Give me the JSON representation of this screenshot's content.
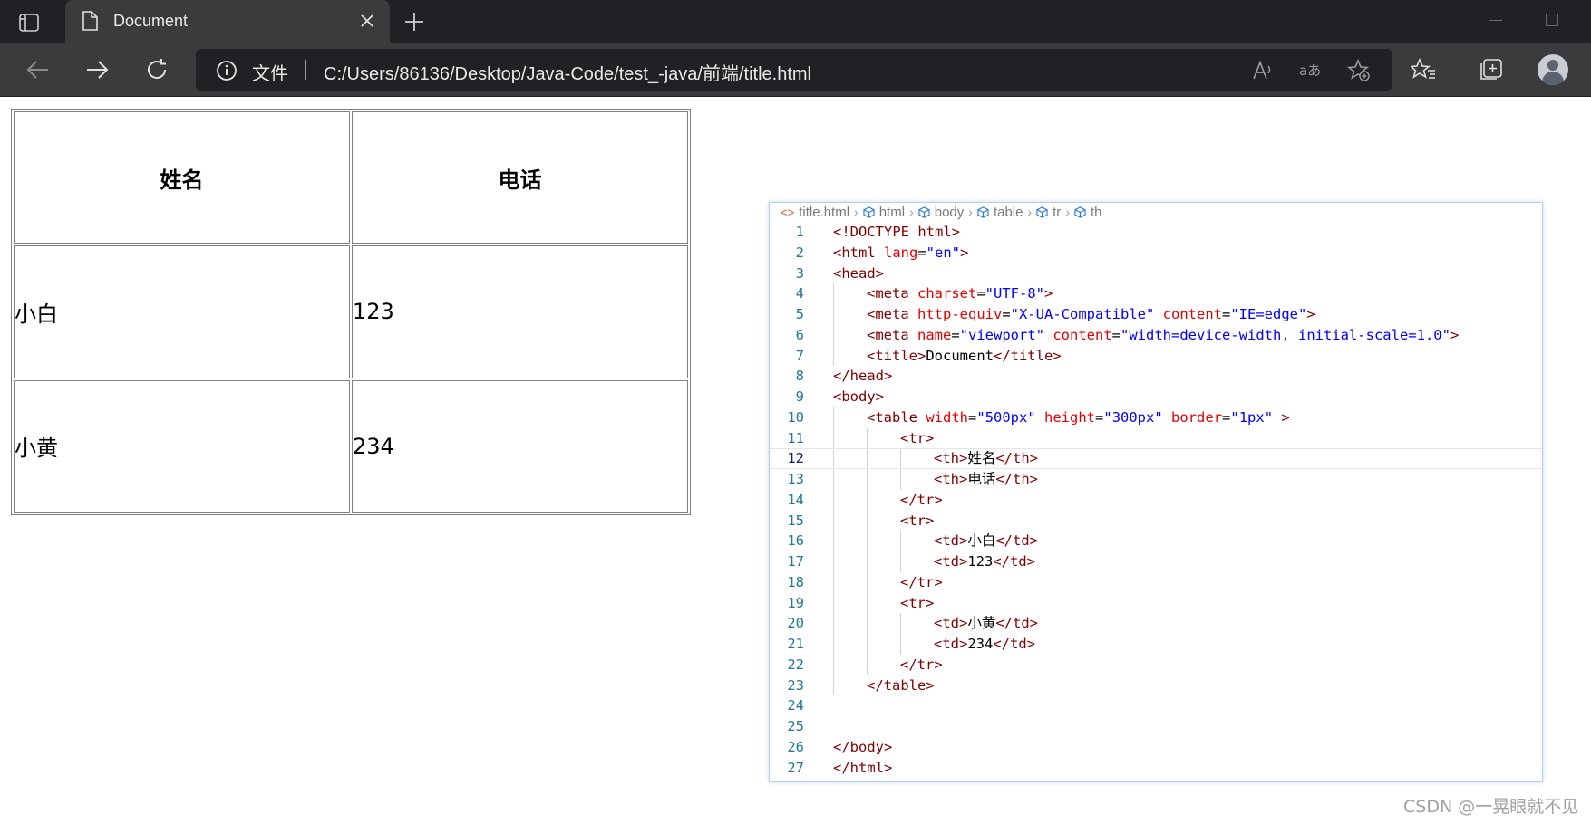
{
  "browser": {
    "tab_title": "Document",
    "address": {
      "label": "文件",
      "url": "C:/Users/86136/Desktop/Java-Code/test_-java/前端/title.html"
    }
  },
  "page_table": {
    "headers": [
      "姓名",
      "电话"
    ],
    "rows": [
      [
        "小白",
        "123"
      ],
      [
        "小黄",
        "234"
      ]
    ]
  },
  "editor": {
    "breadcrumbs": [
      "title.html",
      "html",
      "body",
      "table",
      "tr",
      "th"
    ],
    "current_line": 12,
    "lines": [
      {
        "n": "1",
        "indent": 0,
        "tokens": [
          [
            "t-tag",
            "<!DOCTYPE html>"
          ]
        ]
      },
      {
        "n": "2",
        "indent": 0,
        "tokens": [
          [
            "t-tag",
            "<html "
          ],
          [
            "t-attr",
            "lang"
          ],
          [
            "t-text",
            "="
          ],
          [
            "t-val",
            "\"en\""
          ],
          [
            "t-tag",
            ">"
          ]
        ]
      },
      {
        "n": "3",
        "indent": 0,
        "tokens": [
          [
            "t-tag",
            "<head>"
          ]
        ]
      },
      {
        "n": "4",
        "indent": 1,
        "tokens": [
          [
            "t-tag",
            "<meta "
          ],
          [
            "t-attr",
            "charset"
          ],
          [
            "t-text",
            "="
          ],
          [
            "t-val",
            "\"UTF-8\""
          ],
          [
            "t-tag",
            ">"
          ]
        ]
      },
      {
        "n": "5",
        "indent": 1,
        "tokens": [
          [
            "t-tag",
            "<meta "
          ],
          [
            "t-attr",
            "http-equiv"
          ],
          [
            "t-text",
            "="
          ],
          [
            "t-val",
            "\"X-UA-Compatible\""
          ],
          [
            "t-text",
            " "
          ],
          [
            "t-attr",
            "content"
          ],
          [
            "t-text",
            "="
          ],
          [
            "t-val",
            "\"IE=edge\""
          ],
          [
            "t-tag",
            ">"
          ]
        ]
      },
      {
        "n": "6",
        "indent": 1,
        "tokens": [
          [
            "t-tag",
            "<meta "
          ],
          [
            "t-attr",
            "name"
          ],
          [
            "t-text",
            "="
          ],
          [
            "t-val",
            "\"viewport\""
          ],
          [
            "t-text",
            " "
          ],
          [
            "t-attr",
            "content"
          ],
          [
            "t-text",
            "="
          ],
          [
            "t-val",
            "\"width=device-width, initial-scale=1.0\""
          ],
          [
            "t-tag",
            ">"
          ]
        ]
      },
      {
        "n": "7",
        "indent": 1,
        "tokens": [
          [
            "t-tag",
            "<title>"
          ],
          [
            "t-text",
            "Document"
          ],
          [
            "t-tag",
            "</title>"
          ]
        ]
      },
      {
        "n": "8",
        "indent": 0,
        "tokens": [
          [
            "t-tag",
            "</head>"
          ]
        ]
      },
      {
        "n": "9",
        "indent": 0,
        "tokens": [
          [
            "t-tag",
            "<body>"
          ]
        ]
      },
      {
        "n": "10",
        "indent": 1,
        "tokens": [
          [
            "t-tag",
            "<table "
          ],
          [
            "t-attr",
            "width"
          ],
          [
            "t-text",
            "="
          ],
          [
            "t-val",
            "\"500px\""
          ],
          [
            "t-text",
            " "
          ],
          [
            "t-attr",
            "height"
          ],
          [
            "t-text",
            "="
          ],
          [
            "t-val",
            "\"300px\""
          ],
          [
            "t-text",
            " "
          ],
          [
            "t-attr",
            "border"
          ],
          [
            "t-text",
            "="
          ],
          [
            "t-val",
            "\"1px\""
          ],
          [
            "t-text",
            " "
          ],
          [
            "t-tag",
            ">"
          ]
        ]
      },
      {
        "n": "11",
        "indent": 2,
        "tokens": [
          [
            "t-tag",
            "<tr>"
          ]
        ]
      },
      {
        "n": "12",
        "indent": 3,
        "tokens": [
          [
            "t-tag",
            "<th>"
          ],
          [
            "t-text",
            "姓名"
          ],
          [
            "t-tag",
            "</th>"
          ]
        ]
      },
      {
        "n": "13",
        "indent": 3,
        "tokens": [
          [
            "t-tag",
            "<th>"
          ],
          [
            "t-text",
            "电话"
          ],
          [
            "t-tag",
            "</th>"
          ]
        ]
      },
      {
        "n": "14",
        "indent": 2,
        "tokens": [
          [
            "t-tag",
            "</tr>"
          ]
        ]
      },
      {
        "n": "15",
        "indent": 2,
        "tokens": [
          [
            "t-tag",
            "<tr>"
          ]
        ]
      },
      {
        "n": "16",
        "indent": 3,
        "tokens": [
          [
            "t-tag",
            "<td>"
          ],
          [
            "t-text",
            "小白"
          ],
          [
            "t-tag",
            "</td>"
          ]
        ]
      },
      {
        "n": "17",
        "indent": 3,
        "tokens": [
          [
            "t-tag",
            "<td>"
          ],
          [
            "t-text",
            "123"
          ],
          [
            "t-tag",
            "</td>"
          ]
        ]
      },
      {
        "n": "18",
        "indent": 2,
        "tokens": [
          [
            "t-tag",
            "</tr>"
          ]
        ]
      },
      {
        "n": "19",
        "indent": 2,
        "tokens": [
          [
            "t-tag",
            "<tr>"
          ]
        ]
      },
      {
        "n": "20",
        "indent": 3,
        "tokens": [
          [
            "t-tag",
            "<td>"
          ],
          [
            "t-text",
            "小黄"
          ],
          [
            "t-tag",
            "</td>"
          ]
        ]
      },
      {
        "n": "21",
        "indent": 3,
        "tokens": [
          [
            "t-tag",
            "<td>"
          ],
          [
            "t-text",
            "234"
          ],
          [
            "t-tag",
            "</td>"
          ]
        ]
      },
      {
        "n": "22",
        "indent": 2,
        "tokens": [
          [
            "t-tag",
            "</tr>"
          ]
        ]
      },
      {
        "n": "23",
        "indent": 1,
        "tokens": [
          [
            "t-tag",
            "</table>"
          ]
        ]
      },
      {
        "n": "24",
        "indent": 0,
        "tokens": []
      },
      {
        "n": "25",
        "indent": 0,
        "tokens": []
      },
      {
        "n": "26",
        "indent": 0,
        "tokens": [
          [
            "t-tag",
            "</body>"
          ]
        ]
      },
      {
        "n": "27",
        "indent": 0,
        "tokens": [
          [
            "t-tag",
            "</html>"
          ]
        ]
      }
    ]
  },
  "watermark": "CSDN @一晃眼就不见",
  "icons": {
    "tab_list": "tab-list-icon",
    "page": "page-icon",
    "close": "close-icon",
    "new_tab": "plus-icon",
    "back": "back-arrow-icon",
    "forward": "forward-arrow-icon",
    "refresh": "refresh-icon",
    "info": "info-icon",
    "read_aloud": "read-aloud-icon",
    "translate": "translate-icon",
    "add_favorite": "add-favorite-icon",
    "favorites": "favorites-icon",
    "collections": "collections-icon",
    "profile": "avatar"
  }
}
